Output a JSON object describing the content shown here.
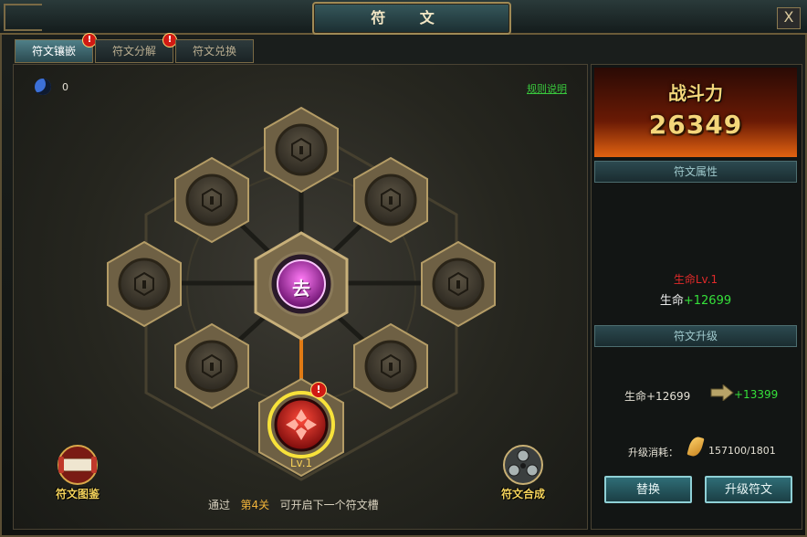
{
  "window": {
    "title": "符 文",
    "close_label": "X"
  },
  "tabs": [
    {
      "label": "符文镶嵌",
      "active": true,
      "badge": "!"
    },
    {
      "label": "符文分解",
      "active": false,
      "badge": "!"
    },
    {
      "label": "符文兑换",
      "active": false,
      "badge": ""
    }
  ],
  "board": {
    "moon_count": "0",
    "rules_link": "规则说明",
    "center_rune_glyph": "去",
    "equipped_rune_level": "Lv.1",
    "equipped_badge": "!",
    "hint": {
      "prefix": "通过",
      "stage": "第4关",
      "suffix": "可开启下一个符文槽"
    },
    "codex_button": "符文图鉴",
    "combine_button": "符文合成"
  },
  "power": {
    "label": "战斗力",
    "value": "26349"
  },
  "attributes": {
    "header": "符文属性",
    "rune_name": "生命Lv.1",
    "stat_label": "生命",
    "stat_value": "+12699"
  },
  "upgrade": {
    "header": "符文升级",
    "current": "生命+12699",
    "next": "+13399",
    "cost_label": "升级消耗：",
    "cost_value": "157100/1801",
    "replace_button": "替换",
    "upgrade_button": "升级符文"
  },
  "colors": {
    "accent": "#f5cf58",
    "positive": "#35e03a",
    "rune_red": "#c81e22",
    "rune_magenta": "#b12ab8",
    "link": "#39c83d"
  }
}
